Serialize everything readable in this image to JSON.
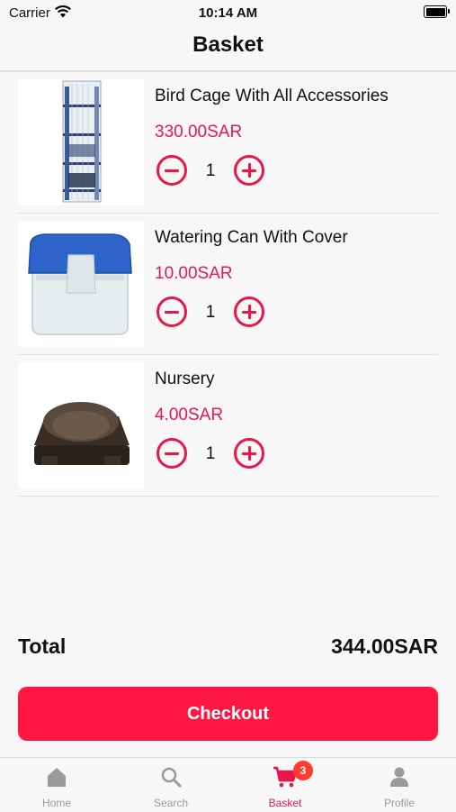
{
  "status_bar": {
    "carrier": "Carrier",
    "time": "10:14 AM"
  },
  "nav": {
    "title": "Basket"
  },
  "items": [
    {
      "name": "Bird Cage With All Accessories",
      "price": "330.00SAR",
      "quantity": "1",
      "image": "bird-cage"
    },
    {
      "name": "Watering Can With Cover",
      "price": "10.00SAR",
      "quantity": "1",
      "image": "watering-can"
    },
    {
      "name": "Nursery",
      "price": "4.00SAR",
      "quantity": "1",
      "image": "nursery-bowl"
    }
  ],
  "summary": {
    "total_label": "Total",
    "total_value": "344.00SAR"
  },
  "checkout": {
    "label": "Checkout"
  },
  "tabs": [
    {
      "label": "Home",
      "icon": "home-icon",
      "active": false
    },
    {
      "label": "Search",
      "icon": "search-icon",
      "active": false
    },
    {
      "label": "Basket",
      "icon": "cart-icon",
      "active": true,
      "badge": "3"
    },
    {
      "label": "Profile",
      "icon": "profile-icon",
      "active": false
    }
  ],
  "colors": {
    "accent": "#e8174a",
    "checkout_bg": "#ff1744",
    "badge_bg": "#ff3b30",
    "inactive_tab": "#9a9a9a"
  }
}
